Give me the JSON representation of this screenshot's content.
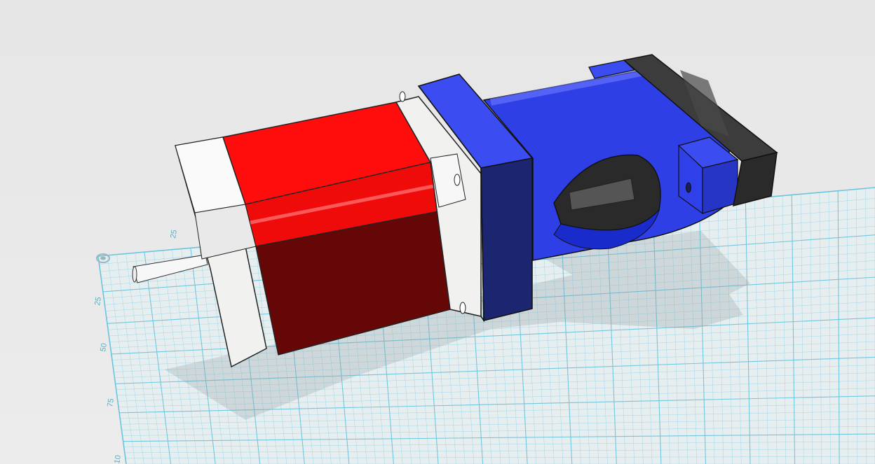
{
  "viewport": {
    "background": "#e9e9e9",
    "grid_color": "#6cc5dc"
  },
  "grid": {
    "labels": {
      "top": "25",
      "left": [
        "25",
        "50",
        "75",
        "10"
      ]
    },
    "origin_marker": "origin-ring-icon"
  },
  "model": {
    "motor_color": "#ff0c0c",
    "motor_shadow_color": "#650707",
    "end_cap_color": "#f1f1ef",
    "adapter_color": "#2e3fe6",
    "adapter_dark_color": "#1c2570",
    "coupler_color": "#3c3c3c",
    "shaft_color": "#f7f7f7"
  }
}
